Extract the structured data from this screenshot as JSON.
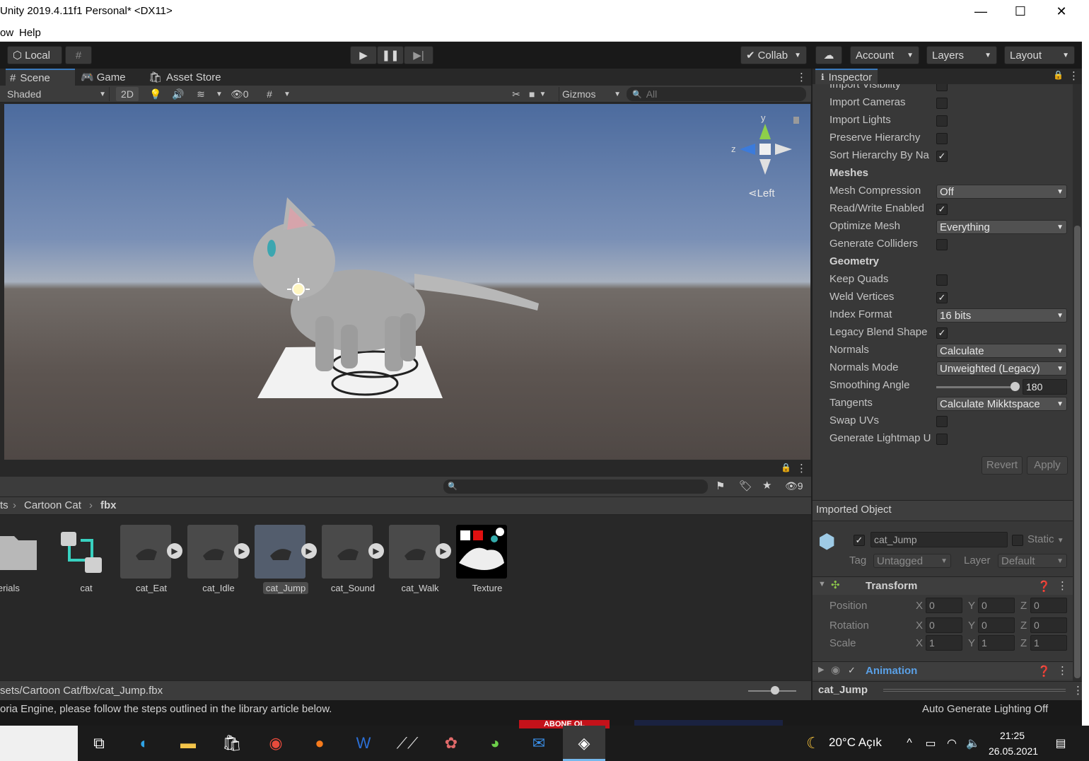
{
  "window": {
    "title": "Unity 2019.4.11f1 Personal* <DX11>",
    "minimize": "—",
    "maximize": "☐",
    "close": "✕"
  },
  "menu": {
    "items": [
      "ow",
      "Help"
    ]
  },
  "toolbar": {
    "local": "Local",
    "collab": "Collab",
    "account": "Account",
    "layers": "Layers",
    "layout": "Layout"
  },
  "scene": {
    "tabs": [
      "Scene",
      "Game",
      "Asset Store"
    ],
    "shading": "Shaded",
    "mode_2d": "2D",
    "hidden_count": "0",
    "gizmos": "Gizmos",
    "search_placeholder": "All",
    "view_label": "Left",
    "axis_y": "y",
    "axis_z": "z"
  },
  "project": {
    "search_placeholder": "",
    "hidden_count": "9",
    "breadcrumb": [
      "ts",
      "Cartoon Cat",
      "fbx"
    ],
    "assets": [
      "aterials",
      "cat",
      "cat_Eat",
      "cat_Idle",
      "cat_Jump",
      "cat_Sound",
      "cat_Walk",
      "Texture"
    ],
    "selected_path": "sets/Cartoon Cat/fbx/cat_Jump.fbx"
  },
  "inspector": {
    "tab": "Inspector",
    "rows": [
      {
        "label": "Import Visibility",
        "type": "check",
        "checked": false
      },
      {
        "label": "Import Cameras",
        "type": "check",
        "checked": false
      },
      {
        "label": "Import Lights",
        "type": "check",
        "checked": false
      },
      {
        "label": "Preserve Hierarchy",
        "type": "check",
        "checked": false
      },
      {
        "label": "Sort Hierarchy By Na",
        "type": "check",
        "checked": true
      },
      {
        "label": "Meshes",
        "type": "header"
      },
      {
        "label": "Mesh Compression",
        "type": "dropdown",
        "value": "Off"
      },
      {
        "label": "Read/Write Enabled",
        "type": "check",
        "checked": true
      },
      {
        "label": "Optimize Mesh",
        "type": "dropdown",
        "value": "Everything"
      },
      {
        "label": "Generate Colliders",
        "type": "check",
        "checked": false
      },
      {
        "label": "Geometry",
        "type": "header"
      },
      {
        "label": "Keep Quads",
        "type": "check",
        "checked": false
      },
      {
        "label": "Weld Vertices",
        "type": "check",
        "checked": true
      },
      {
        "label": "Index Format",
        "type": "dropdown",
        "value": "16 bits"
      },
      {
        "label": "Legacy Blend Shape",
        "type": "check",
        "checked": true
      },
      {
        "label": "Normals",
        "type": "dropdown",
        "value": "Calculate"
      },
      {
        "label": "Normals Mode",
        "type": "dropdown",
        "value": "Unweighted (Legacy)"
      },
      {
        "label": "Smoothing Angle",
        "type": "slider",
        "value": "180"
      },
      {
        "label": "Tangents",
        "type": "dropdown",
        "value": "Calculate Mikktspace"
      },
      {
        "label": "Swap UVs",
        "type": "check",
        "checked": false
      },
      {
        "label": "Generate Lightmap U",
        "type": "check",
        "checked": false
      }
    ],
    "revert": "Revert",
    "apply": "Apply",
    "check_mark": "✓",
    "imported_object": "Imported Object",
    "object_name": "cat_Jump",
    "static_label": "Static",
    "tag_label": "Tag",
    "tag_value": "Untagged",
    "layer_label": "Layer",
    "layer_value": "Default",
    "transform": {
      "title": "Transform",
      "rows": [
        {
          "label": "Position",
          "x": "0",
          "y": "0",
          "z": "0"
        },
        {
          "label": "Rotation",
          "x": "0",
          "y": "0",
          "z": "0"
        },
        {
          "label": "Scale",
          "x": "1",
          "y": "1",
          "z": "1"
        }
      ],
      "axes": [
        "X",
        "Y",
        "Z"
      ]
    },
    "animation_title": "Animation",
    "footer_name": "cat_Jump"
  },
  "status": {
    "message": "oria Engine, please follow the steps outlined in the library article below.",
    "lighting": "Auto Generate Lighting Off"
  },
  "taskbar": {
    "banner": "ABONE OL",
    "weather": "20°C  Açık",
    "time": "21:25",
    "date": "26.05.2021"
  },
  "colors": {
    "accent": "#3a79bb",
    "link": "#5aa0e6",
    "panel": "#383838"
  }
}
